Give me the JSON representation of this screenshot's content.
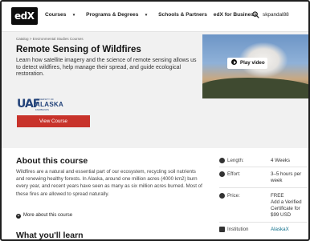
{
  "nav": {
    "logo": "edX",
    "items": [
      {
        "label": "Courses",
        "caret": true
      },
      {
        "label": "Programs & Degrees",
        "caret": true
      },
      {
        "label": "Schools & Partners",
        "caret": false
      },
      {
        "label": "edX for Business",
        "caret": false
      }
    ],
    "username": "skpandal88",
    "icons": {
      "search": "search-icon",
      "caret": "chevron-down-icon"
    }
  },
  "hero": {
    "breadcrumb": "Catalog  >  Environmental Studies Courses",
    "title": "Remote Sensing of Wildfires",
    "description": "Learn how satellite imagery and the science of remote sensing allows us to detect wildfires, help manage their spread, and guide ecological restoration.",
    "partner_logo": {
      "mark": "UAF",
      "line1": "UNIVERSITY OF",
      "line2": "ALASKA",
      "line3": "FAIRBANKS"
    },
    "play_label": "Play video",
    "view_course_label": "View Course",
    "background_color": "#f1f1f1",
    "button_color": "#c8332b"
  },
  "about": {
    "title": "About this course",
    "text": "Wildfires are a natural and essential part of our ecosystem, recycling soil nutrients and renewing healthy forests. In Alaska, around one million acres (4000 km2) burn every year, and recent years have seen as many as six million acres burned. Most of these fires are allowed to spread naturally.",
    "more_label": "More about this course",
    "learn_title": "What you'll learn"
  },
  "facts": [
    {
      "icon": "clock-icon",
      "label": "Length:",
      "value": "4 Weeks"
    },
    {
      "icon": "gauge-icon",
      "label": "Effort:",
      "value": "3–5 hours per week"
    },
    {
      "icon": "tag-icon",
      "label": "Price:",
      "value": "FREE\nAdd a Verified Certificate for $99 USD"
    },
    {
      "icon": "institution-icon",
      "label": "Institution",
      "value": "AlaskaX"
    }
  ]
}
